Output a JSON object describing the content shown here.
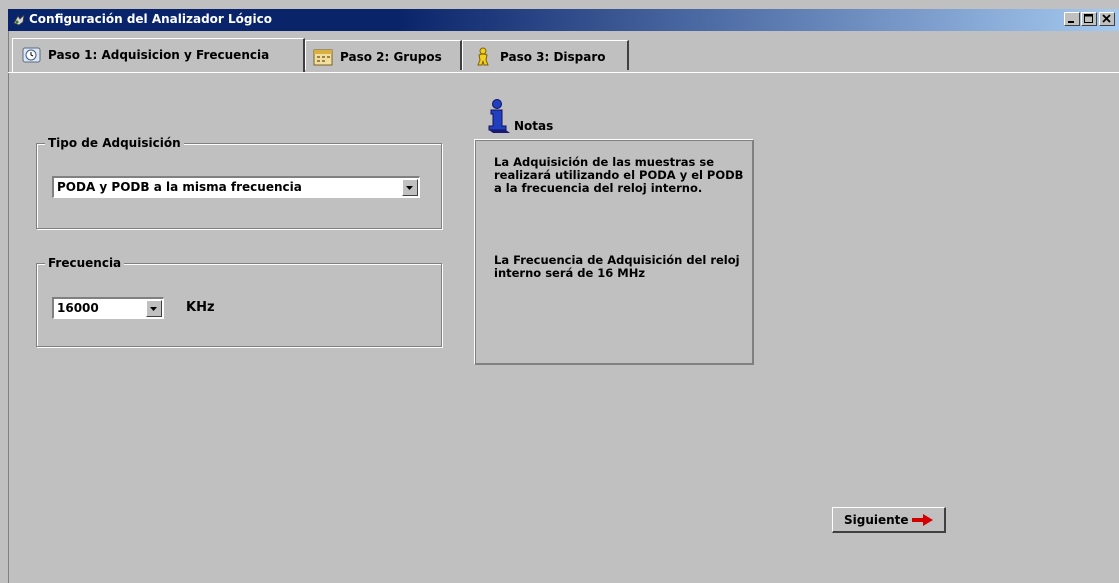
{
  "window": {
    "title": "Configuración del Analizador Lógico",
    "buttons": [
      "minimize",
      "maximize",
      "close"
    ]
  },
  "tabs": [
    {
      "label": "Paso 1: Adquisicion y Frecuencia",
      "icon": "clock-icon",
      "active": true
    },
    {
      "label": "Paso 2: Grupos",
      "icon": "calendar-icon",
      "active": false
    },
    {
      "label": "Paso 3: Disparo",
      "icon": "person-icon",
      "active": false
    }
  ],
  "acquisition": {
    "legend": "Tipo de Adquisición",
    "selected": "PODA y PODB a la misma frecuencia"
  },
  "frequency": {
    "legend": "Frecuencia",
    "selected": "16000",
    "unit": "KHz"
  },
  "notes": {
    "title": "Notas",
    "paragraph1": "La Adquisición de las muestras se realizará utilizando el PODA y el PODB a la frecuencia del reloj interno.",
    "paragraph2": "La Frecuencia de Adquisición del reloj interno será de 16 MHz"
  },
  "next_button": {
    "label": "Siguiente"
  },
  "colors": {
    "face": "#c0c0c0",
    "titlebar_start": "#0a246a",
    "titlebar_end": "#a6caf0",
    "arrow_red": "#d40000"
  }
}
